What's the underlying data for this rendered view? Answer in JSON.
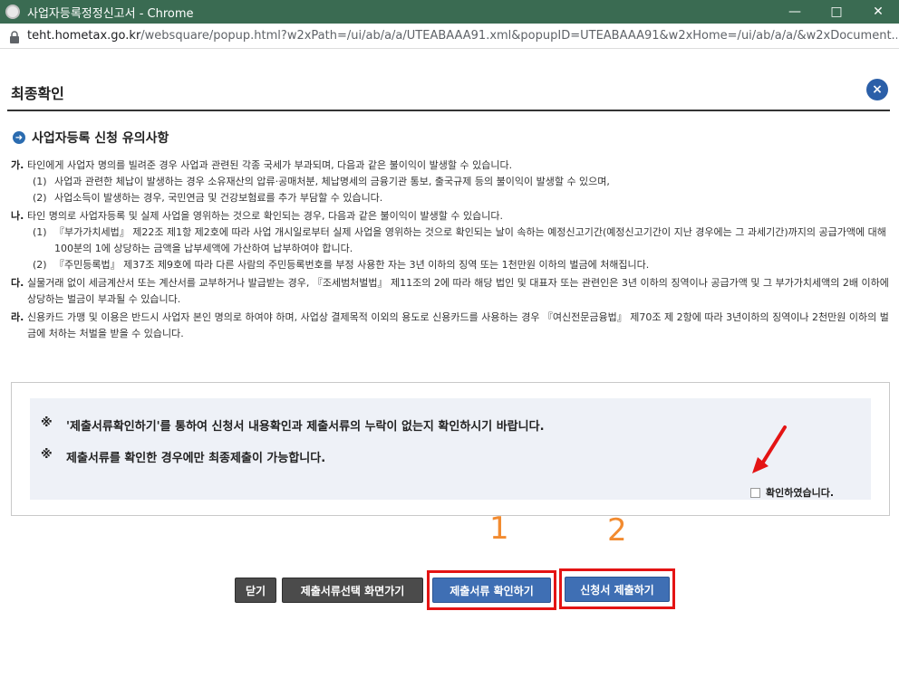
{
  "window": {
    "title": "사업자등록정정신고서 - Chrome",
    "controls": [
      "minimize-icon",
      "maximize-icon",
      "close-icon"
    ]
  },
  "address": {
    "host": "teht.hometax.go.kr",
    "path": "/websquare/popup.html?w2xPath=/ui/ab/a/a/UTEABAAA91.xml&popupID=UTEABAAA91&w2xHome=/ui/ab/a/a/&w2xDocument..."
  },
  "popup": {
    "title": "최종확인",
    "close_label": "×",
    "section_title": "사업자등록 신청 유의사항"
  },
  "notes": [
    {
      "mark": "가.",
      "text": "타인에게 사업자 명의를 빌려준 경우 사업과 관련된 각종 국세가 부과되며, 다음과 같은 불이익이 발생할 수 있습니다.",
      "subs": [
        {
          "num": "(1)",
          "text": "사업과 관련한 체납이 발생하는 경우 소유재산의 압류·공매처분, 체납명세의 금융기관 통보, 출국규제 등의 불이익이 발생할 수 있으며,"
        },
        {
          "num": "(2)",
          "text": "사업소득이 발생하는 경우, 국민연금 및 건강보험료를 추가 부담할 수 있습니다."
        }
      ]
    },
    {
      "mark": "나.",
      "text": "타인 명의로 사업자등록 및 실제 사업을 영위하는 것으로 확인되는 경우, 다음과 같은 불이익이 발생할 수 있습니다.",
      "subs": [
        {
          "num": "(1)",
          "text": "『부가가치세법』 제22조 제1항 제2호에 따라 사업 개시일로부터 실제 사업을 영위하는 것으로 확인되는 날이 속하는 예정신고기간(예정신고기간이 지난 경우에는 그 과세기간)까지의 공급가액에 대해 100분의 1에 상당하는 금액을 납부세액에 가산하여 납부하여야 합니다."
        },
        {
          "num": "(2)",
          "text": "『주민등록법』 제37조 제9호에 따라 다른 사람의 주민등록번호를 부정 사용한 자는 3년 이하의 징역 또는 1천만원 이하의 벌금에 처해집니다."
        }
      ]
    },
    {
      "mark": "다.",
      "text": "실물거래 없이 세금계산서 또는 계산서를 교부하거나 발급받는 경우, 『조세범처벌법』 제11조의 2에 따라 해당 법인 및 대표자 또는 관련인은 3년 이하의 징역이나 공급가액 및 그 부가가치세액의 2배 이하에 상당하는 벌금이 부과될 수 있습니다.",
      "subs": []
    },
    {
      "mark": "라.",
      "text": "신용카드 가맹 및 이용은 반드시 사업자 본인 명의로 하여야 하며, 사업상 결제목적 이외의 용도로 신용카드를 사용하는 경우 『여신전문금융법』 제70조 제 2항에 따라 3년이하의 징역이나 2천만원 이하의 벌금에 처하는 처벌을 받을 수 있습니다.",
      "subs": []
    }
  ],
  "confirm": {
    "star": "※",
    "line1": "'제출서류확인하기'를 통하여 신청서 내용확인과 제출서류의 누락이 없는지 확인하시기 바랍니다.",
    "line2": "제출서류를 확인한 경우에만 최종제출이 가능합니다.",
    "checkbox_label": "확인하였습니다.",
    "checked": false
  },
  "annotations": {
    "num1": "1",
    "num2": "2",
    "highlight_color": "#e41414",
    "number_color": "#f28b30"
  },
  "buttons": {
    "close": "닫기",
    "select_docs": "제출서류선택 화면가기",
    "check_docs": "제출서류 확인하기",
    "submit": "신청서 제출하기"
  }
}
